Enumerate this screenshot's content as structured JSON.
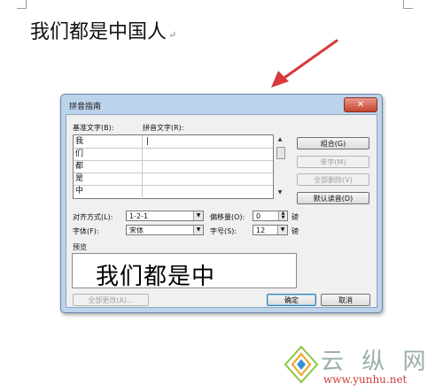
{
  "document": {
    "text": "我们都是中国人",
    "paragraph_mark": "↵"
  },
  "dialog": {
    "title": "拼音指南",
    "close_label": "✕",
    "base_text_label": "基准文字(B):",
    "ruby_text_label": "拼音文字(R):",
    "rows": [
      {
        "base": "我",
        "ruby": "|"
      },
      {
        "base": "们",
        "ruby": ""
      },
      {
        "base": "都",
        "ruby": ""
      },
      {
        "base": "是",
        "ruby": ""
      },
      {
        "base": "中",
        "ruby": ""
      }
    ],
    "buttons": {
      "combine": "组合(G)",
      "single": "单字(M)",
      "clear_all": "全部删除(V)",
      "default_reading": "默认读音(D)",
      "change_all": "全部更改(A)...",
      "ok": "确定",
      "cancel": "取消"
    },
    "alignment": {
      "label": "对齐方式(L):",
      "value": "1-2-1"
    },
    "offset": {
      "label": "偏移量(O):",
      "value": "0",
      "unit": "磅"
    },
    "font": {
      "label": "字体(F):",
      "value": "宋体"
    },
    "size": {
      "label": "字号(S):",
      "value": "12",
      "unit": "磅"
    },
    "preview": {
      "label": "预览",
      "text": "我们都是中"
    }
  },
  "watermark": {
    "text": "云 纵 网",
    "url": "www.yunhu.net"
  }
}
